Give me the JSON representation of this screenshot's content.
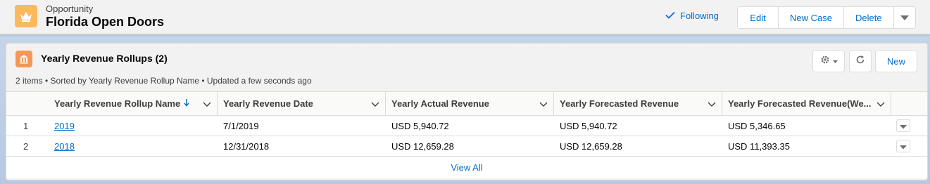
{
  "header": {
    "object_type": "Opportunity",
    "record_name": "Florida Open Doors",
    "following_label": "Following",
    "actions": [
      "Edit",
      "New Case",
      "Delete"
    ]
  },
  "related_list": {
    "title": "Yearly Revenue Rollups (2)",
    "meta": "2 items • Sorted by Yearly Revenue Rollup Name • Updated a few seconds ago",
    "new_label": "New",
    "columns": [
      "Yearly Revenue Rollup Name",
      "Yearly Revenue Date",
      "Yearly Actual Revenue",
      "Yearly Forecasted Revenue",
      "Yearly Forecasted Revenue(We..."
    ],
    "rows": [
      {
        "num": "1",
        "name": "2019",
        "date": "7/1/2019",
        "actual": "USD 5,940.72",
        "forecast": "USD 5,940.72",
        "weighted": "USD 5,346.65"
      },
      {
        "num": "2",
        "name": "2018",
        "date": "12/31/2018",
        "actual": "USD 12,659.28",
        "forecast": "USD 12,659.28",
        "weighted": "USD 11,393.35"
      }
    ],
    "view_all": "View All"
  },
  "colors": {
    "opportunity_icon": "#fcb95b",
    "rollup_icon": "#f49756",
    "link": "#006dcc"
  }
}
